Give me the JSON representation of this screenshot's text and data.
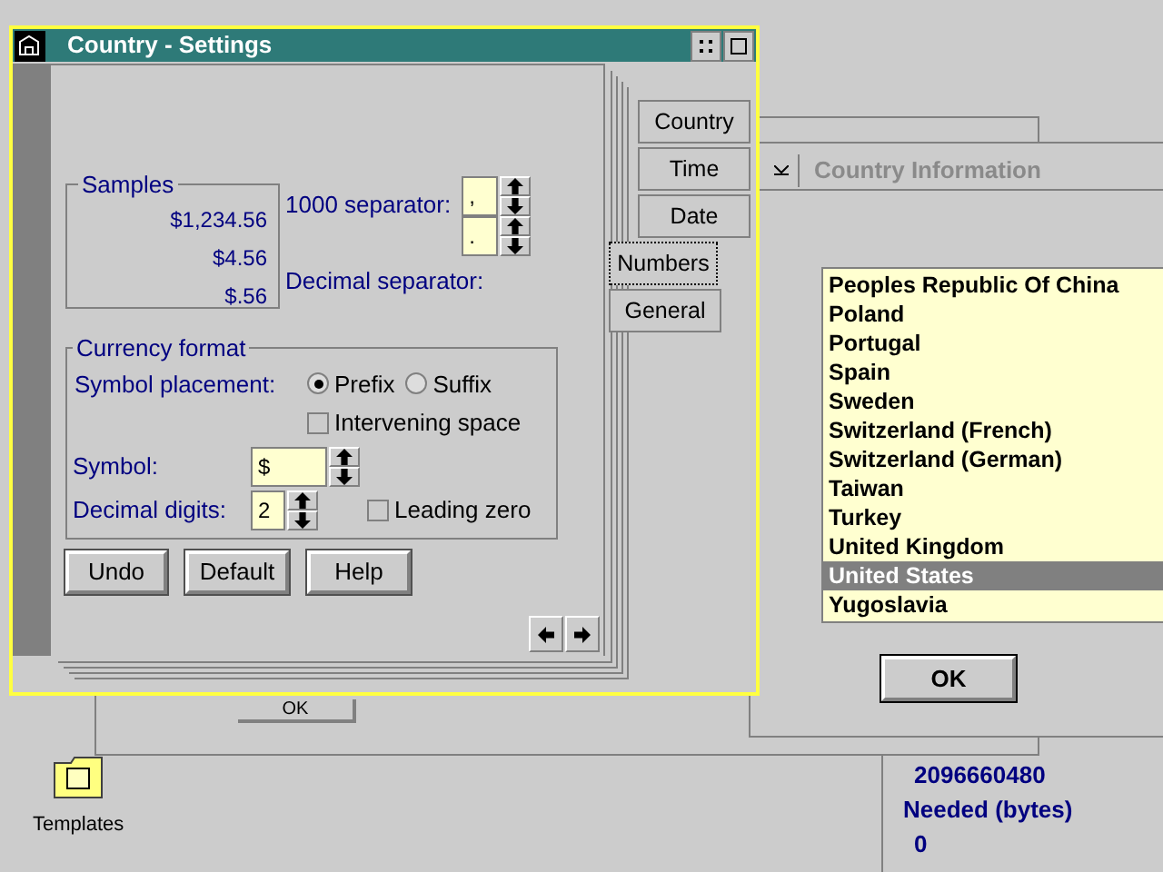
{
  "window": {
    "title": "Country - Settings"
  },
  "samples": {
    "title": "Samples",
    "values": [
      "$1,234.56",
      "$4.56",
      "$.56"
    ]
  },
  "separators": [
    {
      "label": "1000 separator:",
      "value": ","
    },
    {
      "label": "Decimal separator:",
      "value": "."
    }
  ],
  "currency": {
    "title": "Currency format",
    "placement_label": "Symbol placement:",
    "placement_options": [
      {
        "label": "Prefix",
        "selected": true
      },
      {
        "label": "Suffix",
        "selected": false
      }
    ],
    "intervening_space": {
      "label": "Intervening space",
      "checked": false
    },
    "symbol": {
      "label": "Symbol:",
      "value": "$"
    },
    "decimal_digits": {
      "label": "Decimal digits:",
      "value": "2"
    },
    "leading_zero": {
      "label": "Leading zero",
      "checked": false
    }
  },
  "buttons": [
    "Undo",
    "Default",
    "Help"
  ],
  "tabs": [
    {
      "label": "Country",
      "selected": false
    },
    {
      "label": "Time",
      "selected": false
    },
    {
      "label": "Date",
      "selected": false
    },
    {
      "label": "Numbers",
      "selected": true
    },
    {
      "label": "General",
      "selected": false
    }
  ],
  "country_info": {
    "title": "Country Information",
    "countries": [
      {
        "label": "Peoples Republic Of China",
        "selected": false
      },
      {
        "label": "Poland",
        "selected": false
      },
      {
        "label": "Portugal",
        "selected": false
      },
      {
        "label": "Spain",
        "selected": false
      },
      {
        "label": "Sweden",
        "selected": false
      },
      {
        "label": "Switzerland (French)",
        "selected": false
      },
      {
        "label": "Switzerland (German)",
        "selected": false
      },
      {
        "label": "Taiwan",
        "selected": false
      },
      {
        "label": "Turkey",
        "selected": false
      },
      {
        "label": "United Kingdom",
        "selected": false
      },
      {
        "label": "United States",
        "selected": true
      },
      {
        "label": "Yugoslavia",
        "selected": false
      }
    ],
    "ok": "OK"
  },
  "back_window": {
    "ok": "OK"
  },
  "disk_info": {
    "free": "2096660480",
    "needed_label": "Needed (bytes)",
    "needed": "0"
  },
  "desktop_icons": [
    {
      "label": "Templates"
    }
  ]
}
